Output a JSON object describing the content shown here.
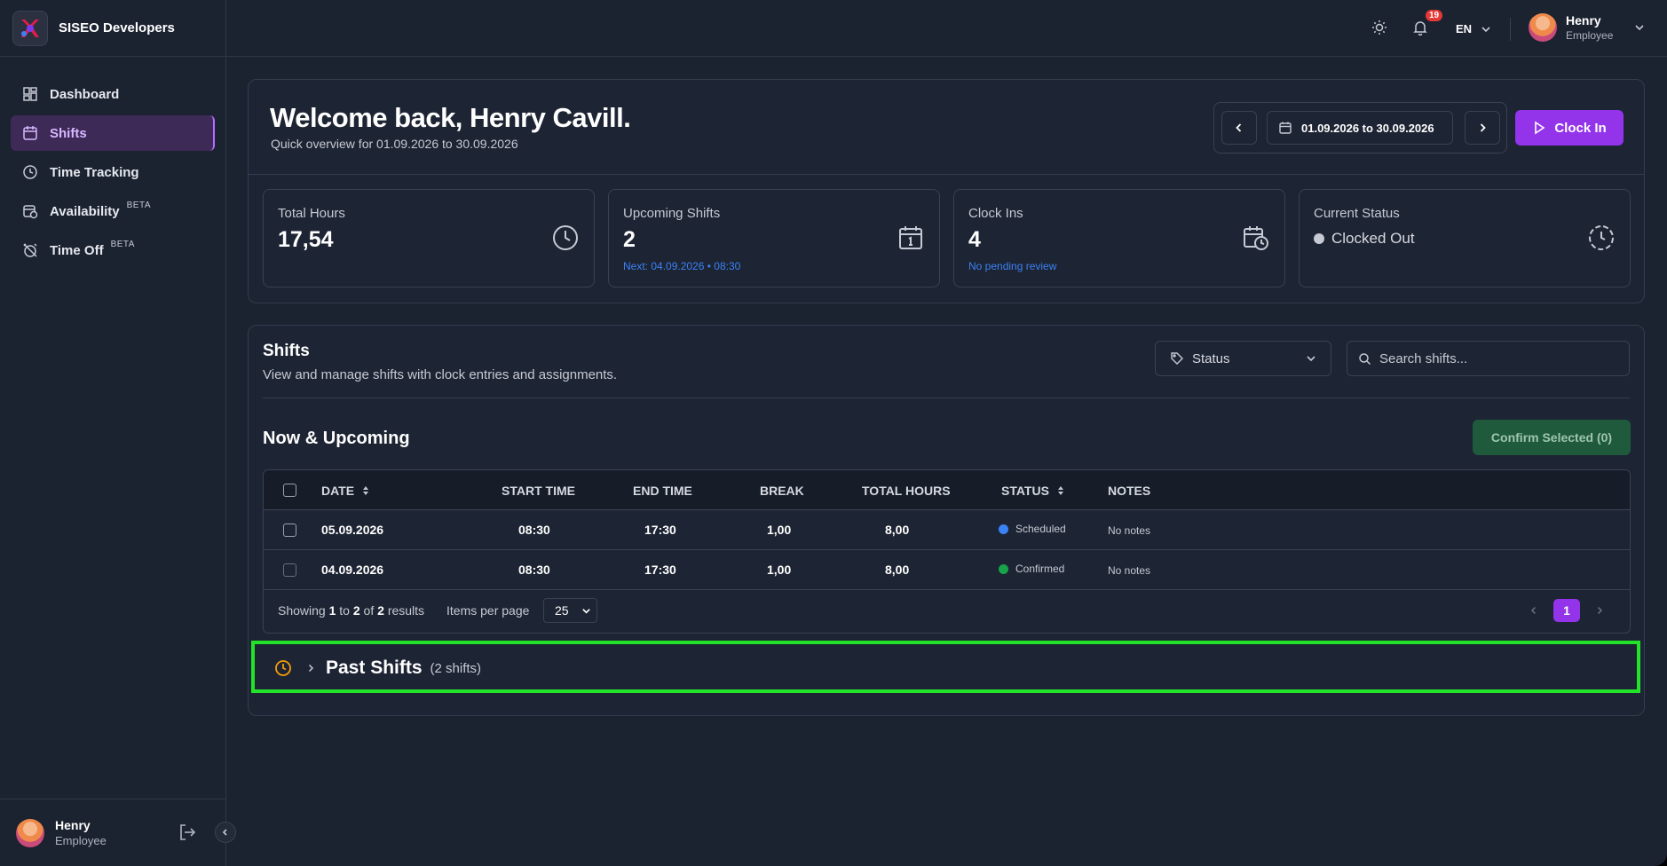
{
  "brand": {
    "name": "SISEO Developers"
  },
  "nav": [
    {
      "label": "Dashboard",
      "icon": "dashboard-icon",
      "active": false,
      "beta": ""
    },
    {
      "label": "Shifts",
      "icon": "calendar-icon",
      "active": true,
      "beta": ""
    },
    {
      "label": "Time Tracking",
      "icon": "clock-icon",
      "active": false,
      "beta": ""
    },
    {
      "label": "Availability",
      "icon": "calendar-clock-icon",
      "active": false,
      "beta": "BETA"
    },
    {
      "label": "Time Off",
      "icon": "alarm-off-icon",
      "active": false,
      "beta": "BETA"
    }
  ],
  "sidebar_user": {
    "name": "Henry",
    "role": "Employee"
  },
  "topbar": {
    "notifications": "19",
    "language": "EN",
    "user_name": "Henry",
    "user_role": "Employee"
  },
  "welcome": {
    "title": "Welcome back, Henry Cavill.",
    "subtitle": "Quick overview for 01.09.2026 to 30.09.2026",
    "date_range": "01.09.2026 to 30.09.2026",
    "clock_in_label": "Clock In"
  },
  "stats": {
    "total_hours": {
      "label": "Total Hours",
      "value": "17,54"
    },
    "upcoming": {
      "label": "Upcoming Shifts",
      "value": "2",
      "note": "Next: 04.09.2026 • 08:30"
    },
    "clock_ins": {
      "label": "Clock Ins",
      "value": "4",
      "note": "No pending review"
    },
    "current_status": {
      "label": "Current Status",
      "value": "Clocked Out"
    }
  },
  "shifts": {
    "title": "Shifts",
    "description": "View and manage shifts with clock entries and assignments.",
    "status_filter": "Status",
    "search_placeholder": "Search shifts...",
    "section_title": "Now & Upcoming",
    "confirm_label": "Confirm Selected (0)",
    "columns": {
      "date": "DATE",
      "start": "START TIME",
      "end": "END TIME",
      "break": "BREAK",
      "total": "TOTAL HOURS",
      "status": "STATUS",
      "notes": "NOTES"
    },
    "rows": [
      {
        "date": "05.09.2026",
        "start": "08:30",
        "end": "17:30",
        "break": "1,00",
        "total": "8,00",
        "status": "Scheduled",
        "status_color": "#3b82f6",
        "notes": "No notes"
      },
      {
        "date": "04.09.2026",
        "start": "08:30",
        "end": "17:30",
        "break": "1,00",
        "total": "8,00",
        "status": "Confirmed",
        "status_color": "#16a34a",
        "notes": "No notes"
      }
    ],
    "footer": {
      "showing_prefix": "Showing",
      "from": "1",
      "to_word": "to",
      "to": "2",
      "of_word": "of",
      "total": "2",
      "results_word": "results",
      "items_per_page_label": "Items per page",
      "items_per_page": "25",
      "current_page": "1"
    }
  },
  "past_shifts": {
    "title": "Past Shifts",
    "count": "(2 shifts)"
  },
  "colors": {
    "accent": "#9333ea",
    "highlight": "#22e22a",
    "scheduled": "#3b82f6",
    "confirmed": "#16a34a"
  }
}
